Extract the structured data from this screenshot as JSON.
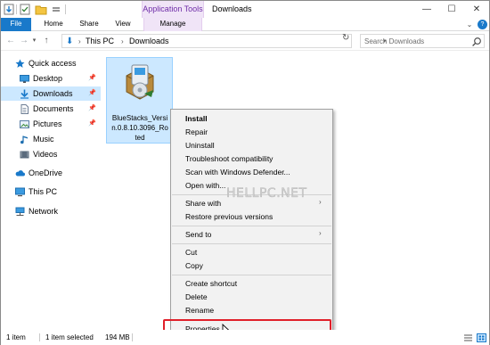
{
  "window": {
    "title": "Downloads",
    "context_tab_title": "Application Tools",
    "controls": {
      "minimize": "—",
      "maximize": "☐",
      "close": "✕"
    }
  },
  "ribbon": {
    "tabs": {
      "file": "File",
      "home": "Home",
      "share": "Share",
      "view": "View",
      "manage": "Manage"
    },
    "help": "?"
  },
  "address": {
    "crumbs": [
      "This PC",
      "Downloads"
    ],
    "separator": "›",
    "search_placeholder": "Search Downloads"
  },
  "sidebar": {
    "items": [
      {
        "label": "Quick access",
        "icon": "star-icon"
      },
      {
        "label": "Desktop",
        "icon": "desktop-icon"
      },
      {
        "label": "Downloads",
        "icon": "download-icon"
      },
      {
        "label": "Documents",
        "icon": "documents-icon"
      },
      {
        "label": "Pictures",
        "icon": "pictures-icon"
      },
      {
        "label": "Music",
        "icon": "music-icon"
      },
      {
        "label": "Videos",
        "icon": "videos-icon"
      },
      {
        "label": "OneDrive",
        "icon": "cloud-icon"
      },
      {
        "label": "This PC",
        "icon": "computer-icon"
      },
      {
        "label": "Network",
        "icon": "network-icon"
      }
    ],
    "pin_glyph": "📌"
  },
  "file": {
    "name_lines": [
      "BlueStacks_Versi",
      "n.0.8.10.3096_Ro",
      "ted"
    ],
    "icon": "installer-package-icon"
  },
  "context_menu": {
    "items": [
      {
        "label": "Install",
        "bold": true
      },
      {
        "label": "Repair"
      },
      {
        "label": "Uninstall"
      },
      {
        "label": "Troubleshoot compatibility"
      },
      {
        "label": "Scan with Windows Defender..."
      },
      {
        "label": "Open with..."
      },
      {
        "label": "Share with",
        "submenu": true
      },
      {
        "label": "Restore previous versions"
      },
      {
        "label": "Send to",
        "submenu": true
      },
      {
        "label": "Cut"
      },
      {
        "label": "Copy"
      },
      {
        "label": "Create shortcut"
      },
      {
        "label": "Delete"
      },
      {
        "label": "Rename"
      },
      {
        "label": "Properties",
        "highlighted": true
      }
    ],
    "submenu_arrow": "›"
  },
  "watermark": "HELLPC.NET",
  "status": {
    "item_count": "1 item",
    "selection": "1 item selected",
    "size": "194 MB"
  },
  "colors": {
    "accent": "#1979ca",
    "selection": "#cce8ff",
    "context_tab": "#f0e4f7",
    "highlight_border": "#e0202a"
  }
}
